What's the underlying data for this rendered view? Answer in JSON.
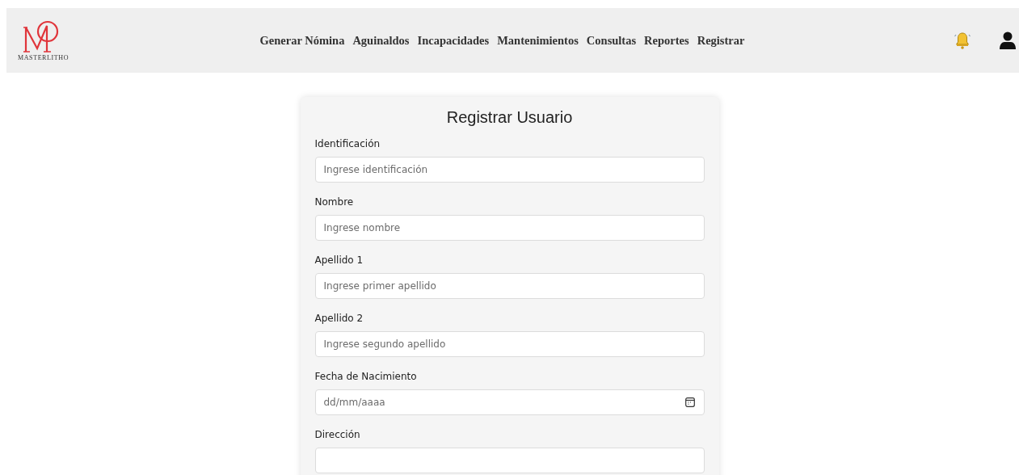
{
  "navbar": {
    "logo_text": "MASTERLITHO",
    "links": [
      {
        "label": "Generar Nómina"
      },
      {
        "label": "Aguinaldos"
      },
      {
        "label": "Incapacidades"
      },
      {
        "label": "Mantenimientos"
      },
      {
        "label": "Consultas"
      },
      {
        "label": "Reportes"
      },
      {
        "label": "Registrar"
      }
    ]
  },
  "form": {
    "title": "Registrar Usuario",
    "fields": [
      {
        "kind": "text",
        "label": "Identificación",
        "placeholder": "Ingrese identificación"
      },
      {
        "kind": "text",
        "label": "Nombre",
        "placeholder": "Ingrese nombre"
      },
      {
        "kind": "text",
        "label": "Apellido 1",
        "placeholder": "Ingrese primer apellido"
      },
      {
        "kind": "text",
        "label": "Apellido 2",
        "placeholder": "Ingrese segundo apellido"
      },
      {
        "kind": "date",
        "label": "Fecha de Nacimiento",
        "placeholder": "dd/mm/aaaa"
      },
      {
        "kind": "text",
        "label": "Dirección"
      }
    ]
  }
}
